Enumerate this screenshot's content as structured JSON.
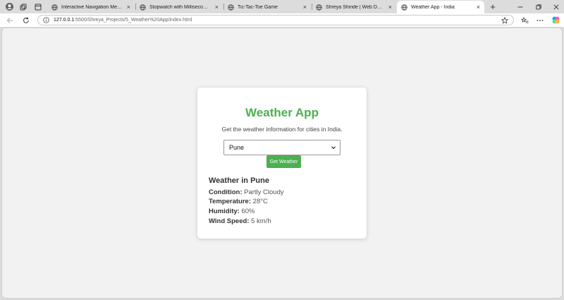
{
  "browser": {
    "tabs": [
      {
        "label": "Interactive Navigation Menu",
        "active": false
      },
      {
        "label": "Stopwatch with Milliseconds",
        "active": false
      },
      {
        "label": "Tic-Tac-Toe Game",
        "active": false
      },
      {
        "label": "Shreya Shinde | Web Developer P",
        "active": false
      },
      {
        "label": "Weather App - India",
        "active": true
      }
    ],
    "new_tab_label": "+",
    "close_label": "×",
    "url_host": "127.0.0.1",
    "url_path": ":5500/Shreya_Projects/5_Weather%20App/index.html"
  },
  "app": {
    "title": "Weather App",
    "subtitle": "Get the weather information for cities in India.",
    "selected_city": "Pune",
    "button_label": "Get Weather",
    "result": {
      "heading": "Weather in Pune",
      "condition_label": "Condition:",
      "condition_value": "Partly Cloudy",
      "temperature_label": "Temperature:",
      "temperature_value": "28°C",
      "humidity_label": "Humidity:",
      "humidity_value": "60%",
      "wind_label": "Wind Speed:",
      "wind_value": "5 km/h"
    }
  },
  "colors": {
    "accent": "#4caf50",
    "page_bg": "#f2f2f2",
    "card_bg": "#ffffff"
  }
}
